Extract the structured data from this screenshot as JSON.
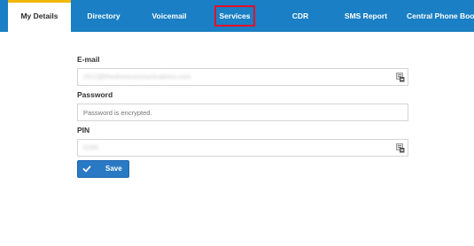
{
  "tabs": [
    {
      "label": "My Details",
      "active": true
    },
    {
      "label": "Directory"
    },
    {
      "label": "Voicemail"
    },
    {
      "label": "Services",
      "highlighted": true
    },
    {
      "label": "CDR"
    },
    {
      "label": "SMS Report"
    },
    {
      "label": "Central Phone Book"
    }
  ],
  "form": {
    "email": {
      "label": "E-mail",
      "value": "2512@thedrawcommunications.com",
      "icon": "password-manager-icon"
    },
    "password": {
      "label": "Password",
      "placeholder": "Password is encrypted."
    },
    "pin": {
      "label": "PIN",
      "value": "6289",
      "icon": "password-manager-icon"
    },
    "save_button": {
      "label": "Save",
      "icon": "check-icon"
    }
  },
  "colors": {
    "tab_bar": "#1a7fc4",
    "active_tab_indicator": "#f2b705",
    "highlight_box": "#e3102a",
    "save_button": "#2a79c5"
  }
}
